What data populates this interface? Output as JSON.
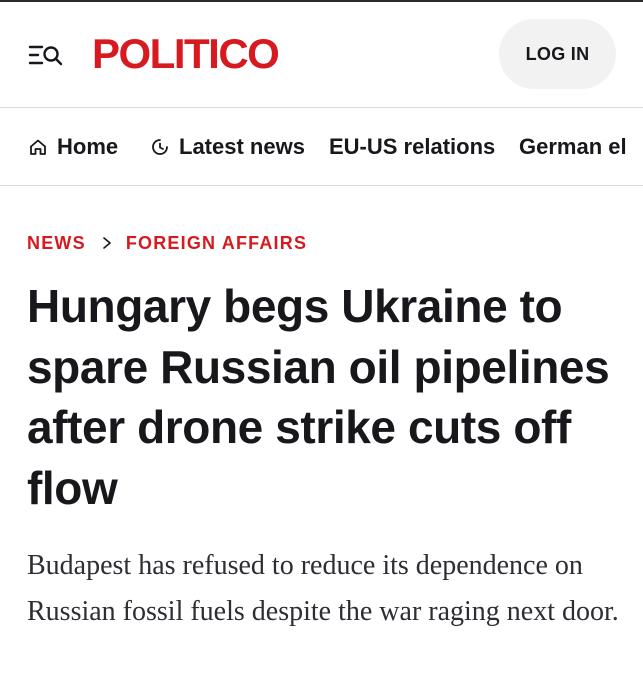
{
  "header": {
    "logo_text": "POLITICO",
    "login_label": "LOG IN",
    "brand_color": "#d71920",
    "menu_search_icon": "menu-search-icon"
  },
  "nav": {
    "items": [
      {
        "label": "Home",
        "icon": "home-icon"
      },
      {
        "label": "Latest news",
        "icon": "clock-icon"
      },
      {
        "label": "EU-US relations"
      },
      {
        "label": "German el"
      }
    ]
  },
  "article": {
    "breadcrumb": [
      "NEWS",
      "FOREIGN AFFAIRS"
    ],
    "headline": "Hungary begs Ukraine to spare Russian oil pipelines after drone strike cuts off flow",
    "dek": "Budapest has refused to reduce its dependence on Russian fossil fuels despite the war raging next door."
  }
}
